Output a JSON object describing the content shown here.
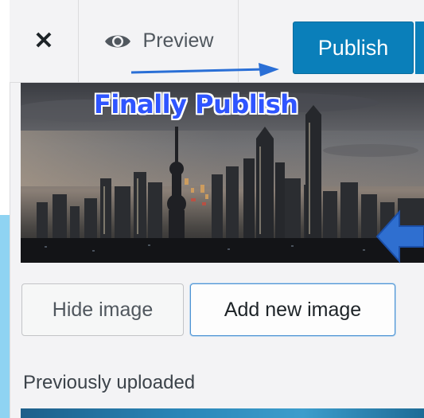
{
  "header": {
    "close_icon": "close-icon",
    "close_glyph": "✕",
    "preview_label": "Preview",
    "preview_icon": "eye-icon",
    "publish_label": "Publish"
  },
  "featured_image": {
    "annotation_text": "Finally Publish",
    "annotation_color": "#2f55ff",
    "arrow_color": "#2a6fd6"
  },
  "actions": {
    "hide_image_label": "Hide image",
    "add_new_image_label": "Add new image"
  },
  "gallery": {
    "heading": "Previously uploaded"
  },
  "colors": {
    "publish_bg": "#0a7fba",
    "panel_bg": "#f3f3f5",
    "backdrop": "#8fd3f2"
  }
}
